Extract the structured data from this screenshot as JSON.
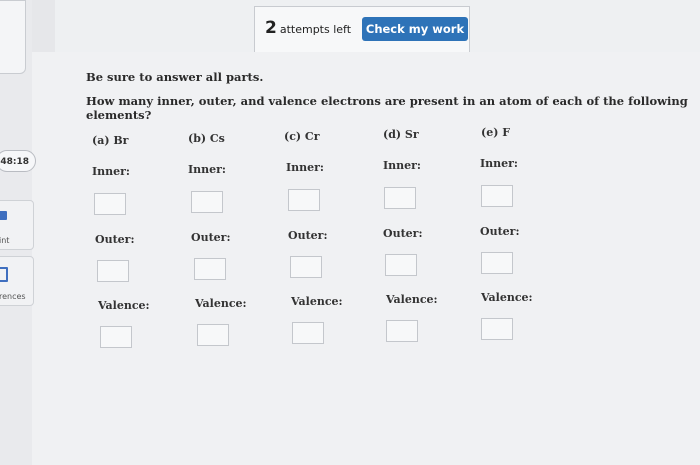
{
  "header": {
    "attempts_count": "2",
    "attempts_text": "attempts left",
    "check_button": "Check my work"
  },
  "sidebar": {
    "timer": "48:18",
    "items": [
      {
        "label": "int"
      },
      {
        "label": "rences"
      }
    ]
  },
  "question": {
    "instruction": "Be sure to answer all parts.",
    "prompt": "How many inner, outer, and valence electrons are present in an atom of each of the following elements?",
    "elements": [
      {
        "label": "(a) Br",
        "inner": "Inner:",
        "outer": "Outer:",
        "valence": "Valence:"
      },
      {
        "label": "(b) Cs",
        "inner": "Inner:",
        "outer": "Outer:",
        "valence": "Valence:"
      },
      {
        "label": "(c) Cr",
        "inner": "Inner:",
        "outer": "Outer:",
        "valence": "Valence:"
      },
      {
        "label": "(d) Sr",
        "inner": "Inner:",
        "outer": "Outer:",
        "valence": "Valence:"
      },
      {
        "label": "(e) F",
        "inner": "Inner:",
        "outer": "Outer:",
        "valence": "Valence:"
      }
    ]
  }
}
